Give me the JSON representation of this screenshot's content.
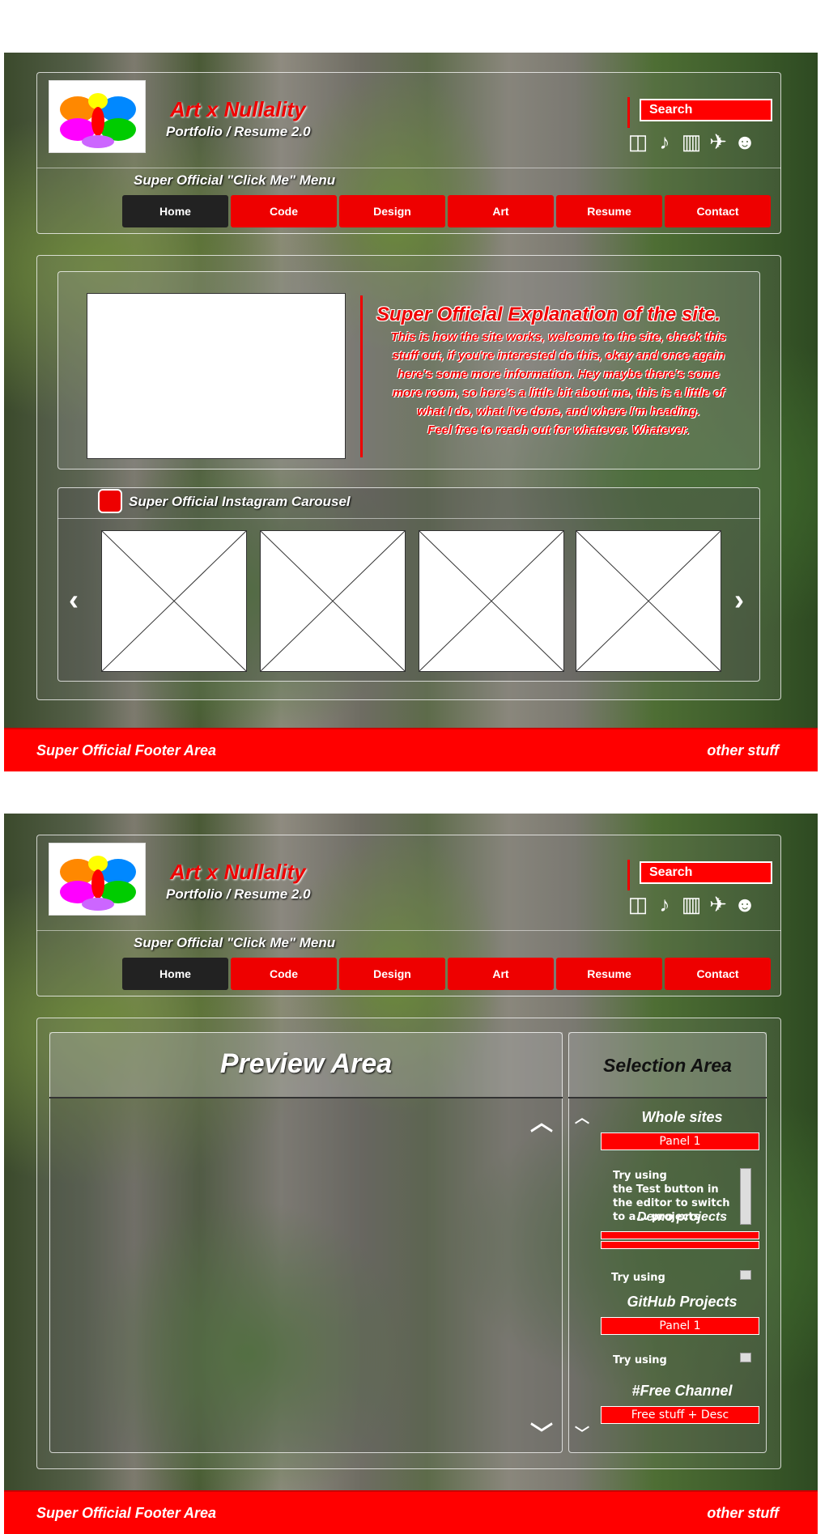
{
  "header": {
    "title": "Art x Nullality",
    "subtitle": "Portfolio / Resume 2.0",
    "search_label": "Search",
    "social_icons": [
      "instagram-icon",
      "sock-icon",
      "tardis-icon",
      "twitter-icon",
      "github-icon"
    ]
  },
  "menu": {
    "label": "Super Official \"Click Me\" Menu",
    "items": [
      "Home",
      "Code",
      "Design",
      "Art",
      "Resume",
      "Contact"
    ],
    "active": "Home"
  },
  "hero": {
    "heading": "Super Official  Explanation of the site.",
    "lines": [
      "This is how the site works, welcome to the site, check this",
      "stuff out, if you're interested do this, okay and once again",
      "here's some more information.  Hey maybe there's some",
      "more room, so here's a little bit about me, this is a little of",
      "what I do, what I've done, and where I'm heading.",
      "Feel free to reach out for whatever. Whatever."
    ]
  },
  "carousel": {
    "label": "Super Official Instagram Carousel",
    "prev": "‹",
    "next": "›"
  },
  "preview": {
    "title": "Preview Area"
  },
  "selection": {
    "title": "Selection Area",
    "whole_sites": "Whole sites",
    "panel1": "Panel 1",
    "panel1_text": "Try using\nthe Test button in\nthe editor to switch\nto a... projects\nedit its content",
    "demo_projects": "Demo projects",
    "try_using": "Try using",
    "github_projects": "GitHub Projects",
    "panel1b": "Panel 1",
    "try_using2": "Try using",
    "free_channel": "#Free Channel",
    "free_stuff": "Free stuff + Desc"
  },
  "footer": {
    "left": "Super Official Footer Area",
    "right": "other stuff"
  },
  "colors": {
    "accent": "#ff0000",
    "active_nav": "#222222"
  }
}
